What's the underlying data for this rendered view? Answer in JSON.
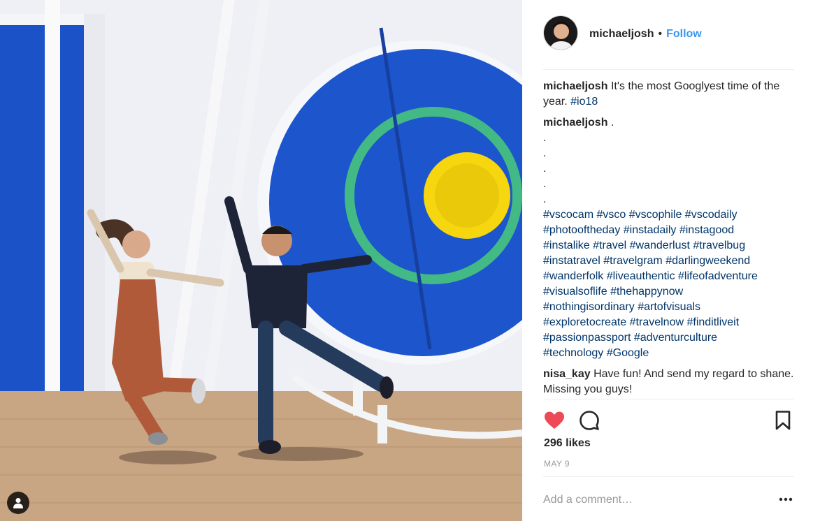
{
  "post": {
    "image_alt": "Two people jumping in front of a large blue and green circular sculpture with a yellow center",
    "author": "michaeljosh",
    "follow_label": "Follow",
    "separator": "•"
  },
  "comments": [
    {
      "user": "michaeljosh",
      "text": "It's the most Googlyest time of the year.",
      "hashtags": [
        "#io18"
      ]
    },
    {
      "user": "michaeljosh",
      "text": ".",
      "dots": [
        ".",
        ".",
        ".",
        ".",
        "."
      ],
      "hashtags": [
        "#vscocam",
        "#vsco",
        "#vscophile",
        "#vscodaily",
        "#photooftheday",
        "#instadaily",
        "#instagood",
        "#instalike",
        "#travel",
        "#wanderlust",
        "#travelbug",
        "#instatravel",
        "#travelgram",
        "#darlingweekend",
        "#wanderfolk",
        "#liveauthentic",
        "#lifeofadventure",
        "#visualsoflife",
        "#thehappynow",
        "#nothingisordinary",
        "#artofvisuals",
        "#exploretocreate",
        "#travelnow",
        "#finditliveit",
        "#passionpassport",
        "#adventurculture",
        "#technology",
        "#Google"
      ]
    },
    {
      "user": "nisa_kay",
      "text": "Have fun! And send my regard to shane. Missing you guys!"
    }
  ],
  "actions": {
    "likes": "296 likes",
    "date": "MAY 9",
    "icons": [
      "heart-filled-icon",
      "comment-icon",
      "bookmark-icon"
    ],
    "like_color": "#ed4956"
  },
  "add_comment": {
    "placeholder": "Add a comment…"
  },
  "colors": {
    "hashtag": "#003569",
    "follow": "#3897f0",
    "muted": "#999999",
    "photo_blue": "#1a4fbf",
    "ring_green": "#3fb37f",
    "center_yellow": "#f7d816"
  }
}
